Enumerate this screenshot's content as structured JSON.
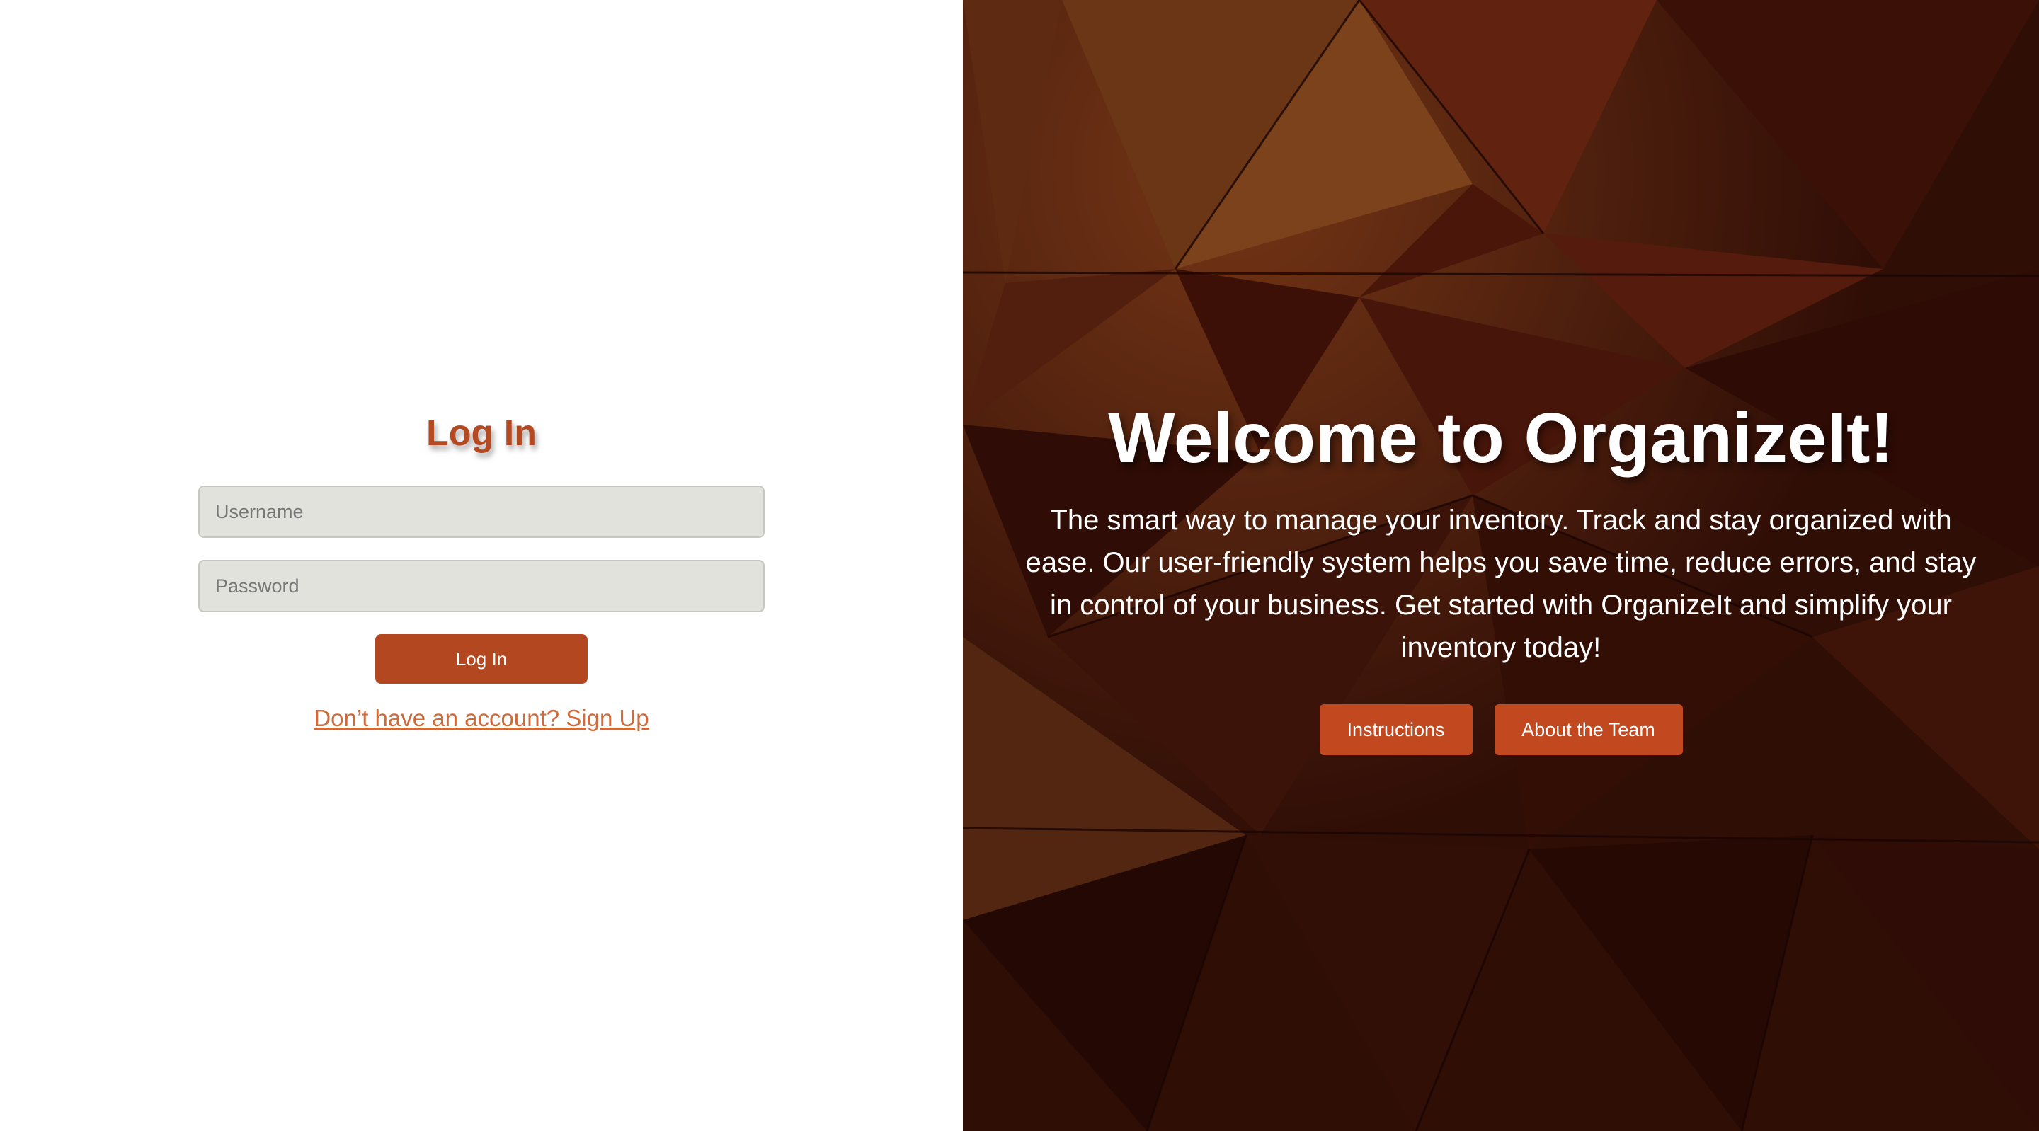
{
  "login": {
    "title": "Log In",
    "username_placeholder": "Username",
    "password_placeholder": "Password",
    "submit_label": "Log In",
    "signup_link": "Don’t have an account? Sign Up"
  },
  "hero": {
    "title": "Welcome to OrganizeIt!",
    "description": "The smart way to manage your inventory. Track and stay organized with ease. Our user-friendly system helps you save time, reduce errors, and stay in control of your business. Get started with OrganizeIt and simplify your inventory today!",
    "buttons": {
      "instructions": "Instructions",
      "about": "About the Team"
    }
  },
  "colors": {
    "accent": "#b34720",
    "link": "#cf6a3a",
    "field_bg": "#e2e2dd",
    "hero_bg": "#3a1208"
  }
}
